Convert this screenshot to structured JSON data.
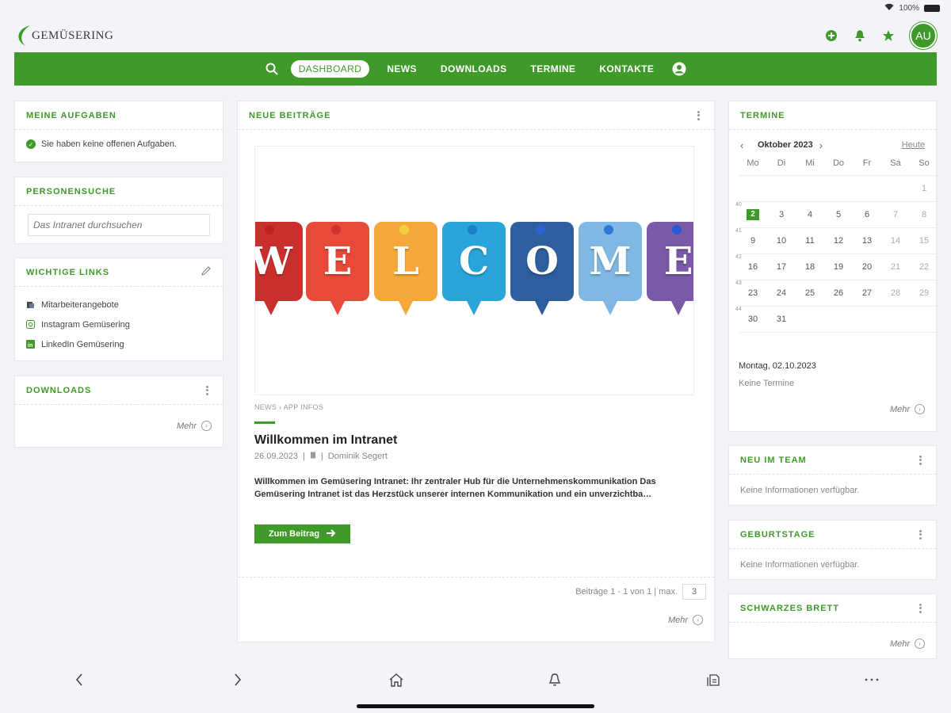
{
  "status": {
    "battery": "100%"
  },
  "header": {
    "logo_text": "GEMÜSERING",
    "avatar_initials": "AU"
  },
  "nav": {
    "items": [
      {
        "label": "DASHBOARD",
        "active": true
      },
      {
        "label": "NEWS"
      },
      {
        "label": "DOWNLOADS"
      },
      {
        "label": "TERMINE"
      },
      {
        "label": "KONTAKTE"
      }
    ]
  },
  "tasks": {
    "title": "MEINE AUFGABEN",
    "message": "Sie haben keine offenen Aufgaben."
  },
  "people_search": {
    "title": "PERSONENSUCHE",
    "placeholder": "Das Intranet durchsuchen"
  },
  "important_links": {
    "title": "WICHTIGE LINKS",
    "items": [
      {
        "label": "Mitarbeiterangebote",
        "icon": "gift-icon"
      },
      {
        "label": "Instagram Gemüsering",
        "icon": "instagram-icon"
      },
      {
        "label": "LinkedIn Gemüsering",
        "icon": "linkedin-icon"
      }
    ]
  },
  "downloads": {
    "title": "DOWNLOADS",
    "more": "Mehr"
  },
  "posts": {
    "title": "NEUE BEITRÄGE",
    "image_letters": [
      "W",
      "E",
      "L",
      "C",
      "O",
      "M",
      "E"
    ],
    "category": "NEWS › APP INFOS",
    "post_title": "Willkommen im Intranet",
    "date": "26.09.2023",
    "author": "Dominik Segert",
    "excerpt": "Willkommen im Gemüsering Intranet: Ihr zentraler Hub für die Unternehmenskommunikation Das Gemüsering Intranet ist das Herzstück unserer internen Kommunikation und ein unverzichtba…",
    "button": "Zum Beitrag",
    "pagination": "Beiträge 1 - 1 von 1 | max.",
    "max_value": "3",
    "more": "Mehr"
  },
  "calendar": {
    "title": "TERMINE",
    "month": "Oktober 2023",
    "today": "Heute",
    "weekdays": [
      "Mo",
      "Di",
      "Mi",
      "Do",
      "Fr",
      "Sa",
      "So"
    ],
    "weeks": [
      {
        "week": "",
        "days": [
          "",
          "",
          "",
          "",
          "",
          "",
          "1"
        ]
      },
      {
        "week": "40",
        "days": [
          "2",
          "3",
          "4",
          "5",
          "6",
          "7",
          "8"
        ]
      },
      {
        "week": "41",
        "days": [
          "9",
          "10",
          "11",
          "12",
          "13",
          "14",
          "15"
        ]
      },
      {
        "week": "42",
        "days": [
          "16",
          "17",
          "18",
          "19",
          "20",
          "21",
          "22"
        ]
      },
      {
        "week": "43",
        "days": [
          "23",
          "24",
          "25",
          "26",
          "27",
          "28",
          "29"
        ]
      },
      {
        "week": "44",
        "days": [
          "30",
          "31",
          "",
          "",
          "",
          "",
          ""
        ]
      }
    ],
    "selected_day": "2",
    "selected_date": "Montag, 02.10.2023",
    "no_events": "Keine Termine",
    "more": "Mehr"
  },
  "new_team": {
    "title": "NEU IM TEAM",
    "message": "Keine Informationen verfügbar."
  },
  "birthdays": {
    "title": "GEBURTSTAGE",
    "message": "Keine Informationen verfügbar."
  },
  "board": {
    "title": "SCHWARZES BRETT",
    "more": "Mehr"
  },
  "colors": {
    "brand": "#3f9a2a"
  }
}
